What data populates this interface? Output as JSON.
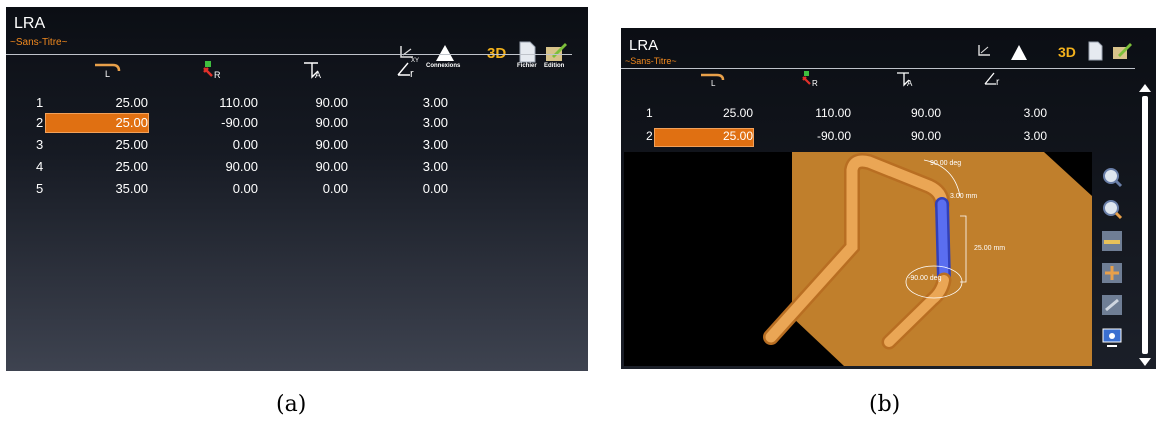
{
  "app_title": "LRA",
  "document_name": "~Sans-Titre~",
  "toolbar": {
    "buttons": [
      {
        "name": "xyz",
        "label": "XYZ",
        "icon": "xyz-axes-icon"
      },
      {
        "name": "connections",
        "label": "Connexions",
        "icon": "bend-connection-icon"
      },
      {
        "name": "3d",
        "label": "3D",
        "icon": "3d-view-icon"
      },
      {
        "name": "file",
        "label": "Fichier",
        "icon": "file-icon"
      },
      {
        "name": "edit",
        "label": "Edition",
        "icon": "edit-pencil-icon"
      }
    ]
  },
  "table": {
    "column_icons": [
      "length-icon",
      "rotation-icon",
      "angle-icon",
      "radius-icon"
    ],
    "column_subscripts": [
      "L",
      "R",
      "A",
      "r"
    ],
    "rows": [
      {
        "num": "1",
        "length": "25.00",
        "rotation": "110.00",
        "angle": "90.00",
        "radius": "3.00"
      },
      {
        "num": "2",
        "length": "25.00",
        "rotation": "-90.00",
        "angle": "90.00",
        "radius": "3.00"
      },
      {
        "num": "3",
        "length": "25.00",
        "rotation": "0.00",
        "angle": "90.00",
        "radius": "3.00"
      },
      {
        "num": "4",
        "length": "25.00",
        "rotation": "90.00",
        "angle": "90.00",
        "radius": "3.00"
      },
      {
        "num": "5",
        "length": "35.00",
        "rotation": "0.00",
        "angle": "0.00",
        "radius": "0.00"
      }
    ],
    "selected_row": 2
  },
  "view3d": {
    "annotations": {
      "bend_angle": "90.00 deg",
      "radius": "3.00 mm",
      "length": "25.00 mm",
      "rotation": "-90.00 deg"
    },
    "side_buttons": [
      "zoom-fit-icon",
      "zoom-icon",
      "view-top-icon",
      "view-side-icon",
      "view-iso-icon",
      "camera-icon"
    ]
  },
  "captions": [
    "(a)",
    "(b)"
  ],
  "colors": {
    "accent": "#f0891f",
    "selection": "#e07012",
    "tube": "#e8a04a",
    "tube_selected": "#4a5de0",
    "plane": "#d08a30"
  }
}
